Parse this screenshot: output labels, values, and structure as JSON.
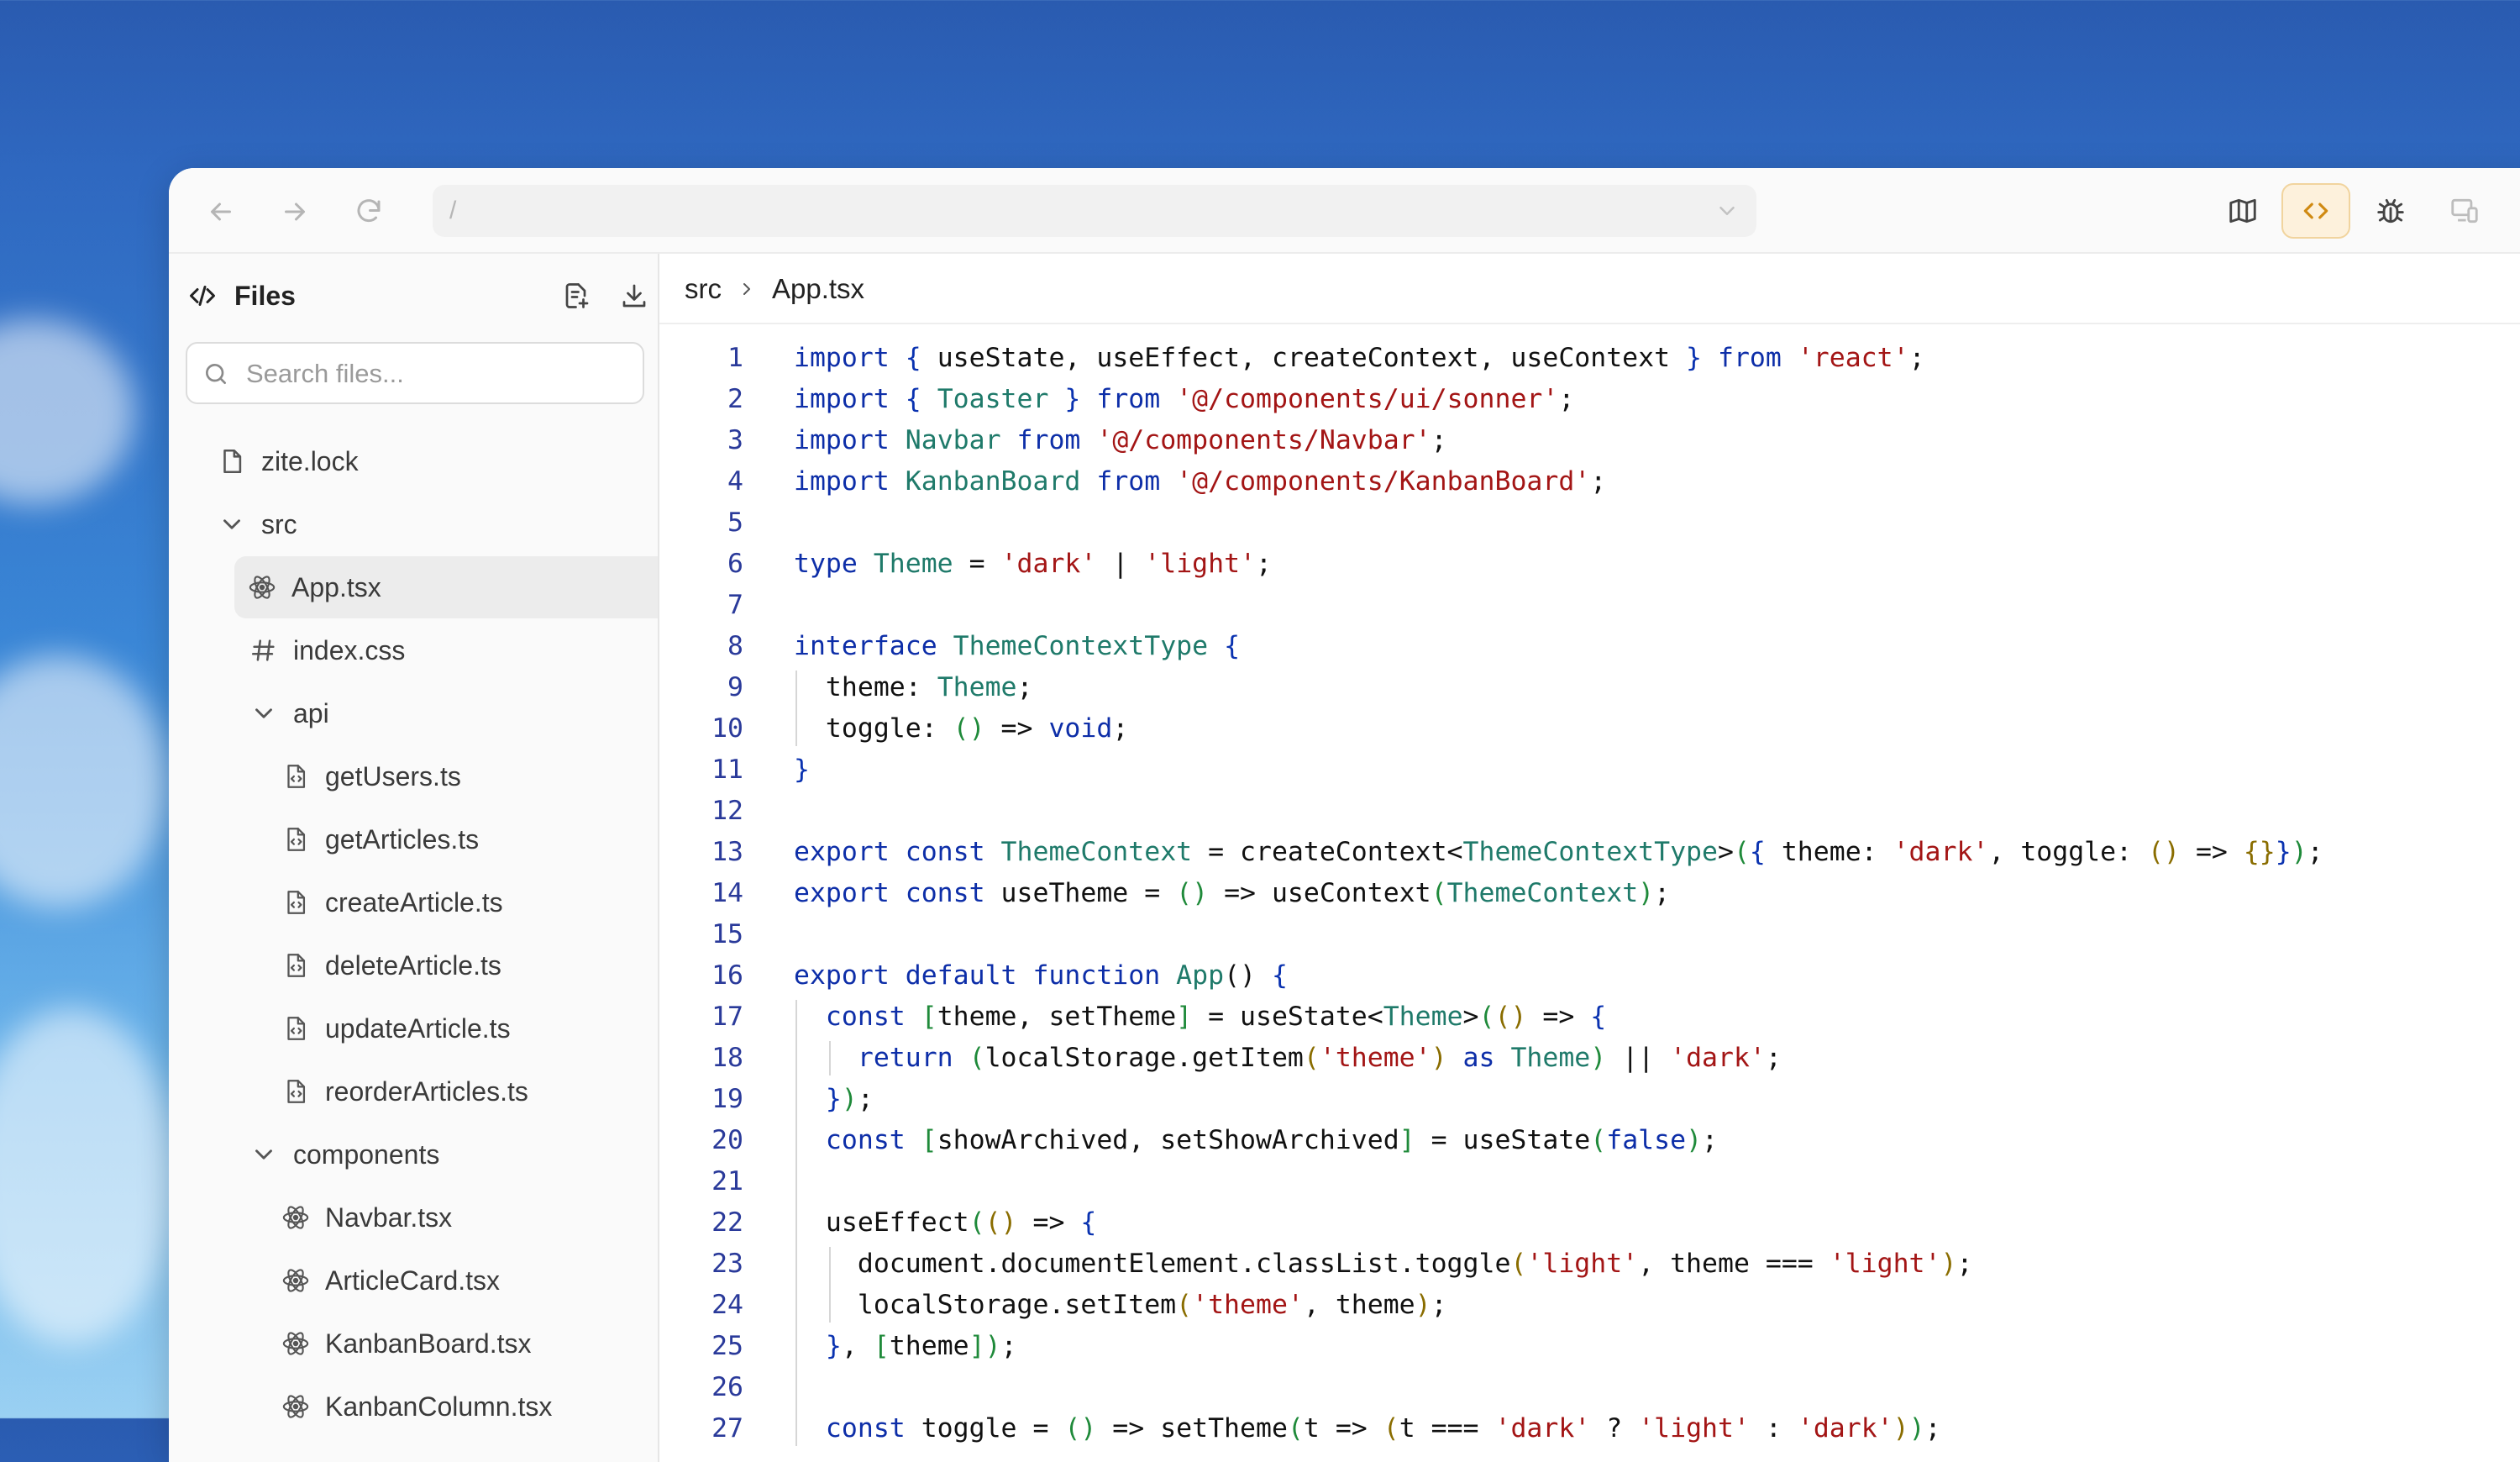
{
  "toolbar": {
    "url": "/"
  },
  "sidebar": {
    "title": "Files",
    "search_placeholder": "Search files...",
    "items": [
      {
        "label": "zite.lock",
        "icon": "file-icon",
        "depth": 0
      },
      {
        "label": "src",
        "icon": "chevron-down-icon",
        "depth": 0
      },
      {
        "label": "App.tsx",
        "icon": "react-icon",
        "depth": 1,
        "selected": true
      },
      {
        "label": "index.css",
        "icon": "hash-icon",
        "depth": 1
      },
      {
        "label": "api",
        "icon": "chevron-down-icon",
        "depth": 1
      },
      {
        "label": "getUsers.ts",
        "icon": "code-file-icon",
        "depth": 2
      },
      {
        "label": "getArticles.ts",
        "icon": "code-file-icon",
        "depth": 2
      },
      {
        "label": "createArticle.ts",
        "icon": "code-file-icon",
        "depth": 2
      },
      {
        "label": "deleteArticle.ts",
        "icon": "code-file-icon",
        "depth": 2
      },
      {
        "label": "updateArticle.ts",
        "icon": "code-file-icon",
        "depth": 2
      },
      {
        "label": "reorderArticles.ts",
        "icon": "code-file-icon",
        "depth": 2
      },
      {
        "label": "components",
        "icon": "chevron-down-icon",
        "depth": 1
      },
      {
        "label": "Navbar.tsx",
        "icon": "react-icon",
        "depth": 2
      },
      {
        "label": "ArticleCard.tsx",
        "icon": "react-icon",
        "depth": 2
      },
      {
        "label": "KanbanBoard.tsx",
        "icon": "react-icon",
        "depth": 2
      },
      {
        "label": "KanbanColumn.tsx",
        "icon": "react-icon",
        "depth": 2
      }
    ]
  },
  "editor": {
    "breadcrumb": [
      "src",
      "App.tsx"
    ],
    "lines": [
      [
        [
          "kw",
          "import "
        ],
        [
          "br",
          "{ "
        ],
        [
          "",
          "useState, useEffect, createContext, useContext "
        ],
        [
          "br",
          "}"
        ],
        [
          "kw",
          " from "
        ],
        [
          "st",
          "'react'"
        ],
        [
          "",
          ";"
        ]
      ],
      [
        [
          "kw",
          "import "
        ],
        [
          "br",
          "{ "
        ],
        [
          "ty",
          "Toaster "
        ],
        [
          "br",
          "}"
        ],
        [
          "kw",
          " from "
        ],
        [
          "st",
          "'@/components/ui/sonner'"
        ],
        [
          "",
          ";"
        ]
      ],
      [
        [
          "kw",
          "import "
        ],
        [
          "ty",
          "Navbar"
        ],
        [
          "kw",
          " from "
        ],
        [
          "st",
          "'@/components/Navbar'"
        ],
        [
          "",
          ";"
        ]
      ],
      [
        [
          "kw",
          "import "
        ],
        [
          "ty",
          "KanbanBoard"
        ],
        [
          "kw",
          " from "
        ],
        [
          "st",
          "'@/components/KanbanBoard'"
        ],
        [
          "",
          ";"
        ]
      ],
      [],
      [
        [
          "kw",
          "type "
        ],
        [
          "ty",
          "Theme"
        ],
        [
          "",
          " = "
        ],
        [
          "st",
          "'dark'"
        ],
        [
          "",
          " | "
        ],
        [
          "st",
          "'light'"
        ],
        [
          "",
          ";"
        ]
      ],
      [],
      [
        [
          "kw",
          "interface "
        ],
        [
          "ty",
          "ThemeContextType "
        ],
        [
          "br",
          "{"
        ]
      ],
      [
        [
          "",
          "  theme: "
        ],
        [
          "ty",
          "Theme"
        ],
        [
          "",
          ";"
        ]
      ],
      [
        [
          "",
          "  toggle: "
        ],
        [
          "pr",
          "()"
        ],
        [
          "",
          " => "
        ],
        [
          "kw",
          "void"
        ],
        [
          "",
          ";"
        ]
      ],
      [
        [
          "br",
          "}"
        ]
      ],
      [],
      [
        [
          "kw",
          "export const "
        ],
        [
          "ty",
          "ThemeContext"
        ],
        [
          "",
          " = createContext<"
        ],
        [
          "ty",
          "ThemeContextType"
        ],
        [
          "",
          ">"
        ],
        [
          "pr",
          "("
        ],
        [
          "br",
          "{"
        ],
        [
          "",
          " theme: "
        ],
        [
          "st",
          "'dark'"
        ],
        [
          "",
          ", toggle: "
        ],
        [
          "yl",
          "()"
        ],
        [
          "",
          " => "
        ],
        [
          "yl",
          "{}"
        ],
        [
          " ",
          ""
        ],
        [
          "br",
          "}"
        ],
        [
          "pr",
          ")"
        ],
        [
          "",
          ";"
        ]
      ],
      [
        [
          "kw",
          "export const "
        ],
        [
          "",
          "useTheme = "
        ],
        [
          "pr",
          "()"
        ],
        [
          "",
          " => useContext"
        ],
        [
          "pr",
          "("
        ],
        [
          "ty",
          "ThemeContext"
        ],
        [
          "pr",
          ")"
        ],
        [
          "",
          ";"
        ]
      ],
      [],
      [
        [
          "kw",
          "export default function "
        ],
        [
          "ty",
          "App"
        ],
        [
          "",
          "() "
        ],
        [
          "br",
          "{"
        ]
      ],
      [
        [
          "kw",
          "  const "
        ],
        [
          "pr",
          "["
        ],
        [
          "",
          "theme, setTheme"
        ],
        [
          "pr",
          "]"
        ],
        [
          "",
          " = useState<"
        ],
        [
          "ty",
          "Theme"
        ],
        [
          "",
          ">"
        ],
        [
          "pr",
          "("
        ],
        [
          "yl",
          "()"
        ],
        [
          "",
          " => "
        ],
        [
          "br",
          "{"
        ]
      ],
      [
        [
          "kw",
          "    return "
        ],
        [
          "pr",
          "("
        ],
        [
          "",
          "localStorage.getItem"
        ],
        [
          "yl",
          "("
        ],
        [
          "st",
          "'theme'"
        ],
        [
          "yl",
          ")"
        ],
        [
          "kw",
          " as "
        ],
        [
          "ty",
          "Theme"
        ],
        [
          "pr",
          ")"
        ],
        [
          "",
          " || "
        ],
        [
          "st",
          "'dark'"
        ],
        [
          "",
          ";"
        ]
      ],
      [
        [
          "br",
          "  }"
        ],
        [
          "pr",
          ")"
        ],
        [
          "",
          ";"
        ]
      ],
      [
        [
          "kw",
          "  const "
        ],
        [
          "pr",
          "["
        ],
        [
          "",
          "showArchived, setShowArchived"
        ],
        [
          "pr",
          "]"
        ],
        [
          "",
          " = useState"
        ],
        [
          "pr",
          "("
        ],
        [
          "kw",
          "false"
        ],
        [
          "pr",
          ")"
        ],
        [
          "",
          ";"
        ]
      ],
      [],
      [
        [
          "",
          "  useEffect"
        ],
        [
          "pr",
          "("
        ],
        [
          "yl",
          "()"
        ],
        [
          "",
          " => "
        ],
        [
          "br",
          "{"
        ]
      ],
      [
        [
          "",
          "    document.documentElement.classList.toggle"
        ],
        [
          "yl",
          "("
        ],
        [
          "st",
          "'light'"
        ],
        [
          "",
          ", theme === "
        ],
        [
          "st",
          "'light'"
        ],
        [
          "yl",
          ")"
        ],
        [
          "",
          ";"
        ]
      ],
      [
        [
          "",
          "    localStorage.setItem"
        ],
        [
          "yl",
          "("
        ],
        [
          "st",
          "'theme'"
        ],
        [
          "",
          ", theme"
        ],
        [
          "yl",
          ")"
        ],
        [
          "",
          ";"
        ]
      ],
      [
        [
          "br",
          "  }"
        ],
        [
          "",
          ", "
        ],
        [
          "pr",
          "["
        ],
        [
          "",
          "theme"
        ],
        [
          "pr",
          "]"
        ],
        [
          "pr",
          ")"
        ],
        [
          "",
          ";"
        ]
      ],
      [],
      [
        [
          "kw",
          "  const "
        ],
        [
          "",
          "toggle = "
        ],
        [
          "pr",
          "()"
        ],
        [
          "",
          " => setTheme"
        ],
        [
          "pr",
          "("
        ],
        [
          "",
          "t => "
        ],
        [
          "yl",
          "("
        ],
        [
          "",
          "t === "
        ],
        [
          "st",
          "'dark'"
        ],
        [
          "",
          " ? "
        ],
        [
          "st",
          "'light'"
        ],
        [
          "",
          " : "
        ],
        [
          "st",
          "'dark'"
        ],
        [
          "yl",
          ")"
        ],
        [
          "pr",
          ")"
        ],
        [
          "",
          ";"
        ]
      ]
    ]
  }
}
